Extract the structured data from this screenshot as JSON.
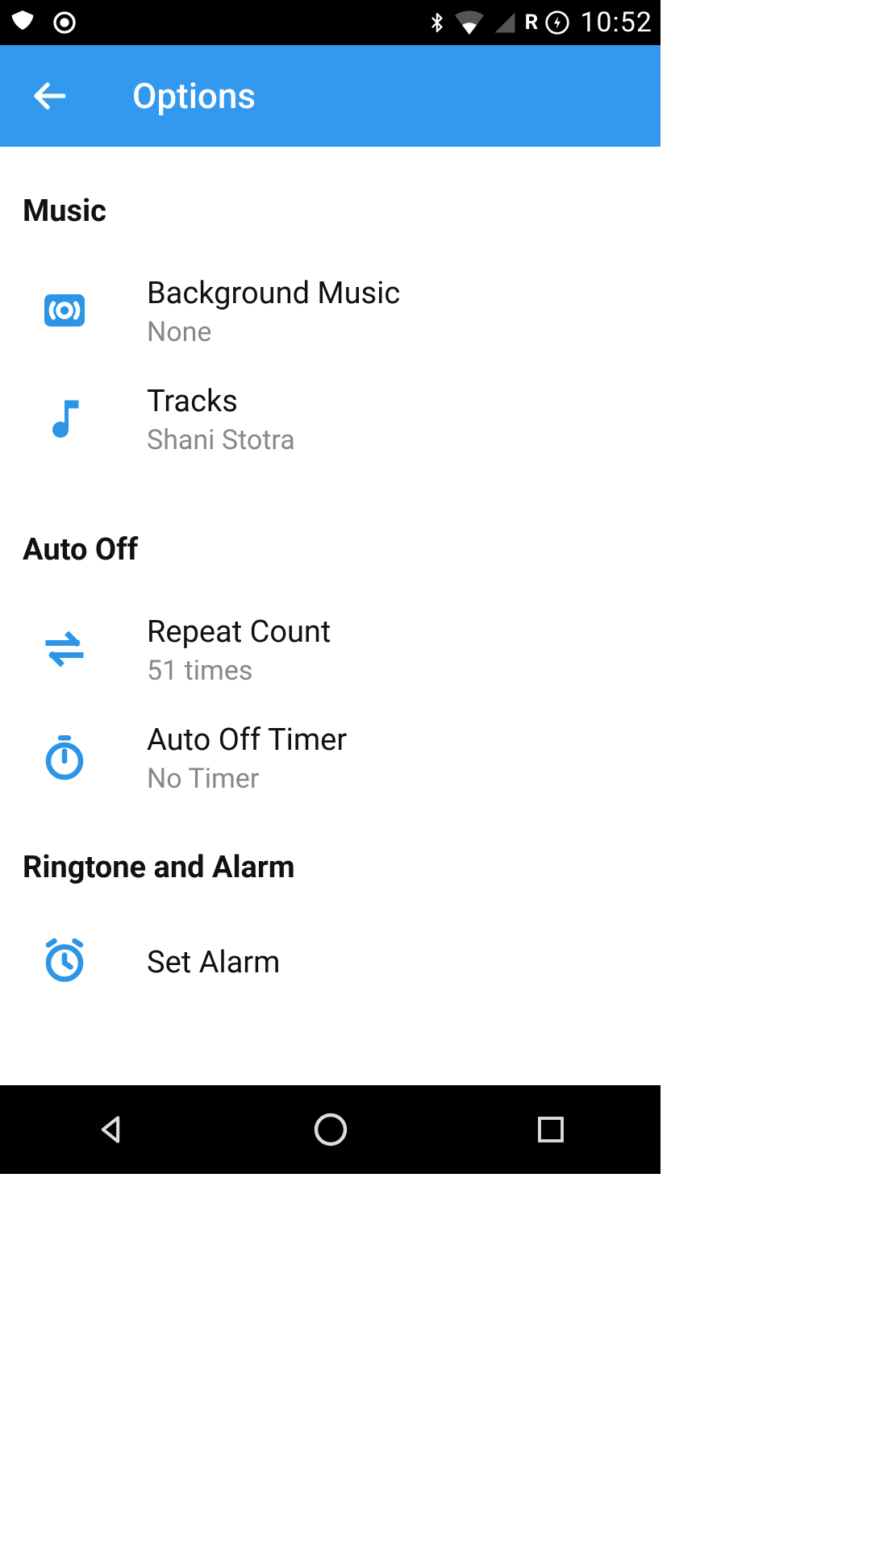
{
  "status": {
    "time": "10:52",
    "roaming": "R"
  },
  "appbar": {
    "title": "Options"
  },
  "sections": {
    "music": {
      "header": "Music",
      "background_music": {
        "title": "Background Music",
        "value": "None"
      },
      "tracks": {
        "title": "Tracks",
        "value": "Shani Stotra"
      }
    },
    "auto_off": {
      "header": "Auto Off",
      "repeat_count": {
        "title": "Repeat Count",
        "value": "51 times"
      },
      "auto_off_timer": {
        "title": "Auto Off Timer",
        "value": "No Timer"
      }
    },
    "ringtone_alarm": {
      "header": "Ringtone and Alarm",
      "set_alarm": {
        "title": "Set Alarm"
      }
    }
  },
  "colors": {
    "accent": "#3399ee"
  }
}
